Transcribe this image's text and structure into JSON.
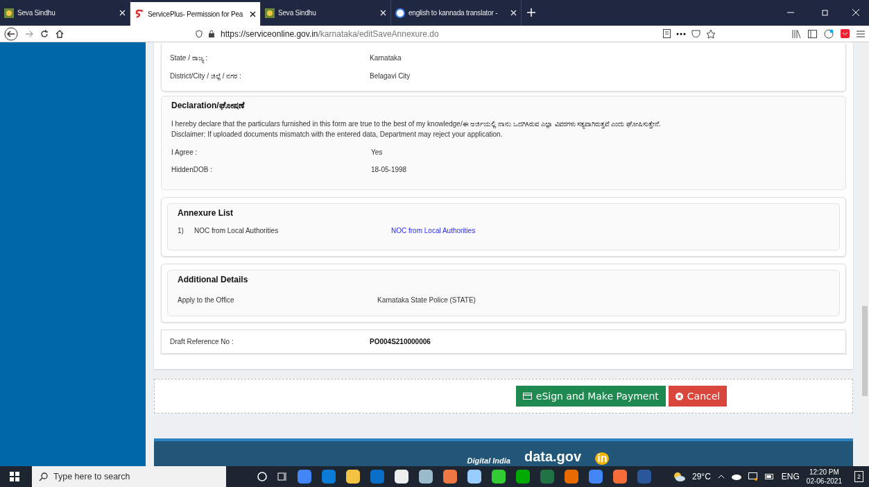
{
  "browser": {
    "tabs": [
      {
        "title": "Seva Sindhu",
        "selected": false
      },
      {
        "title": "ServicePlus- Permission for Pea",
        "selected": true
      },
      {
        "title": "Seva Sindhu",
        "selected": false
      },
      {
        "title": "english to kannada translator -",
        "selected": false
      }
    ],
    "url_host": "https://serviceonline.gov.in",
    "url_path": "/karnataka/editSaveAnnexure.do"
  },
  "location": {
    "rows": [
      {
        "label": "State / ರಾಜ್ಯ :",
        "value": "Karnataka"
      },
      {
        "label": "District/City / ಜಿಲ್ಲೆ / ನಗರ :",
        "value": "Belagavi City"
      }
    ]
  },
  "declaration": {
    "title": "Declaration/ಘೋಷಣೆ",
    "lines": [
      "I hereby declare that the particulars furnished in this form are true to the best of my knowledge/ಈ ಅರ್ಜಿಯಲ್ಲಿ ನಾನು ಒದಗಿಸಿರುವ ಎಲ್ಲಾ ವಿವರಗಳು ಸತ್ಯವಾಗಿರುತ್ತವೆ ಎಂದು ಘೋಷಿಸುತ್ತೇನೆ.",
      "Disclaimer: If uploaded documents mismatch with the entered data, Department may reject your application."
    ],
    "rows": [
      {
        "label": "I Agree :",
        "value": "Yes"
      },
      {
        "label": "HiddenDOB :",
        "value": "18-05-1998"
      }
    ]
  },
  "annexure": {
    "title": "Annexure List",
    "items": [
      {
        "number": "1)",
        "name": "NOC from Local Authorities",
        "link": "NOC from Local Authorities"
      }
    ]
  },
  "additional": {
    "title": "Additional Details",
    "rows": [
      {
        "label": "Apply to the Office",
        "value": "Karnataka State Police (STATE)"
      }
    ]
  },
  "draft": {
    "label": "Draft Reference No :",
    "value": "PO004S210000006"
  },
  "buttons": [
    {
      "label": "eSign and Make Payment",
      "kind": "primary"
    },
    {
      "label": "Cancel",
      "kind": "danger"
    }
  ],
  "footer": {
    "logos": [
      "Digital India",
      "data.gov",
      "in"
    ]
  },
  "taskbar": {
    "search_placeholder": "Type here to search",
    "weather": "29°C",
    "language": "ENG",
    "time": "12:20 PM",
    "date": "02-06-2021",
    "notifications": "2"
  }
}
